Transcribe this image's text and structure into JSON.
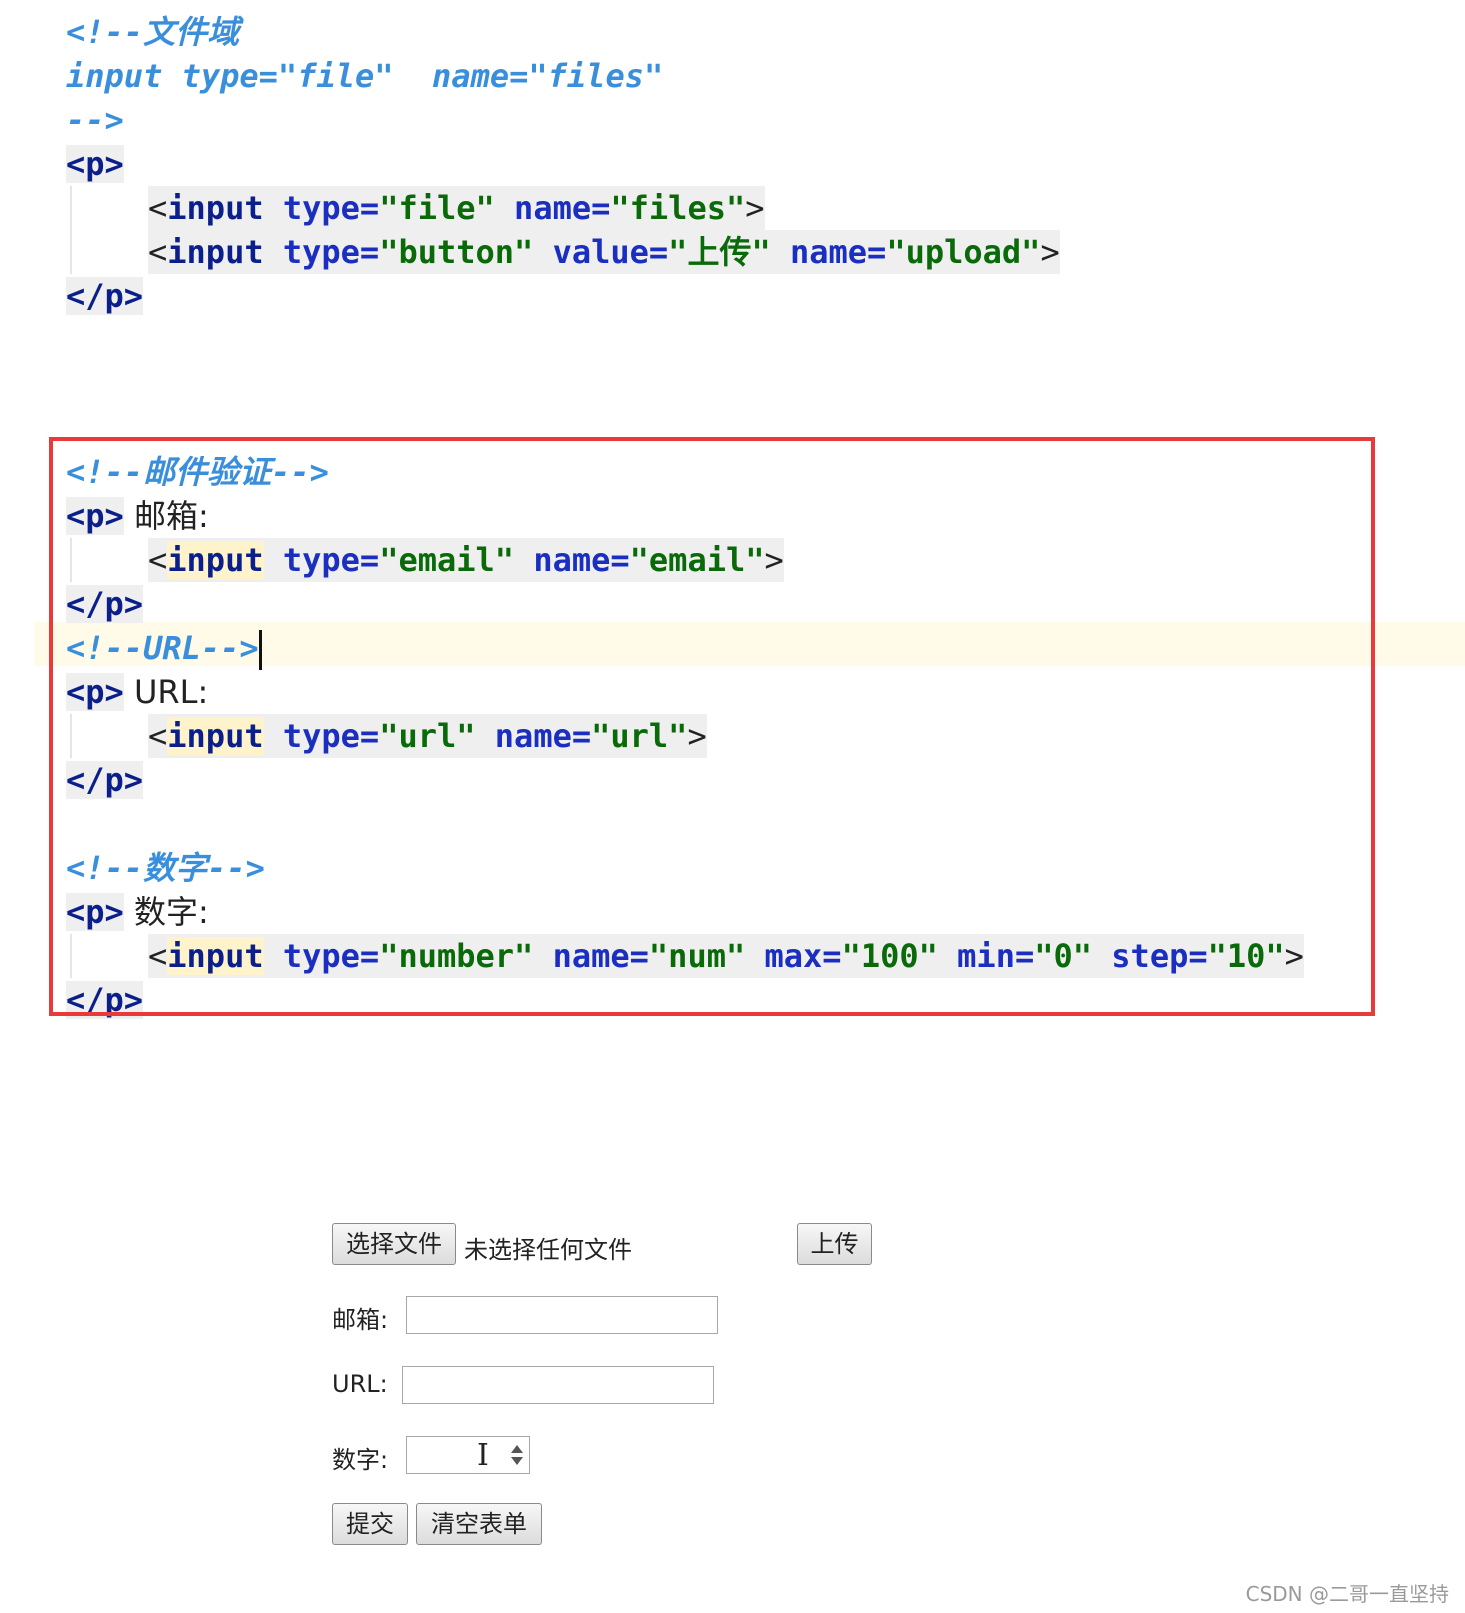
{
  "code_top": {
    "c1": "<!--文件域",
    "c2": "input type=\"file\"  name=\"files\"",
    "c3": "-->",
    "p_open": "<p>",
    "line_file": {
      "lt": "<",
      "kw": "input",
      "a1": " type=",
      "v1": "\"file\"",
      "a2": " name=",
      "v2": "\"files\"",
      "gt": ">"
    },
    "line_btn": {
      "lt": "<",
      "kw": "input",
      "a1": " type=",
      "v1": "\"button\"",
      "a2": " value=",
      "v2": "\"上传\"",
      "a3": " name=",
      "v3": "\"upload\"",
      "gt": ">"
    },
    "p_close": "</p>"
  },
  "code_box": {
    "email_comment": "<!--邮件验证-->",
    "email_p": "<p>",
    "email_label": " 邮箱:",
    "email_input": {
      "lt": "<",
      "kw": "input",
      "a1": " type=",
      "v1": "\"email\"",
      "a2": " name=",
      "v2": "\"email\"",
      "gt": ">"
    },
    "email_close": "</p>",
    "url_comment": "<!--URL-->",
    "url_p": "<p>",
    "url_label": " URL:",
    "url_input": {
      "lt": "<",
      "kw": "input",
      "a1": " type=",
      "v1": "\"url\"",
      "a2": " name=",
      "v2": "\"url\"",
      "gt": ">"
    },
    "url_close": "</p>",
    "num_comment": "<!--数字-->",
    "num_p": "<p>",
    "num_label": " 数字:",
    "num_input": {
      "lt": "<",
      "kw": "input",
      "a1": " type=",
      "v1": "\"number\"",
      "a2": " name=",
      "v2": "\"num\"",
      "a3": " max=",
      "v3": "\"100\"",
      "a4": " min=",
      "v4": "\"0\"",
      "a5": " step=",
      "v5": "\"10\"",
      "gt": ">"
    },
    "num_close": "</p>"
  },
  "form": {
    "choose_file": "选择文件",
    "no_file": "未选择任何文件",
    "upload": "上传",
    "email_label": "邮箱:",
    "url_label": "URL:",
    "num_label": "数字:",
    "submit": "提交",
    "reset": "清空表单"
  },
  "footer": "CSDN @二哥一直坚持",
  "colors": {
    "comment": "#3a8fdc",
    "keyword": "#0b1f8a",
    "string": "#0a6a0a",
    "box": "#e83a3a"
  }
}
